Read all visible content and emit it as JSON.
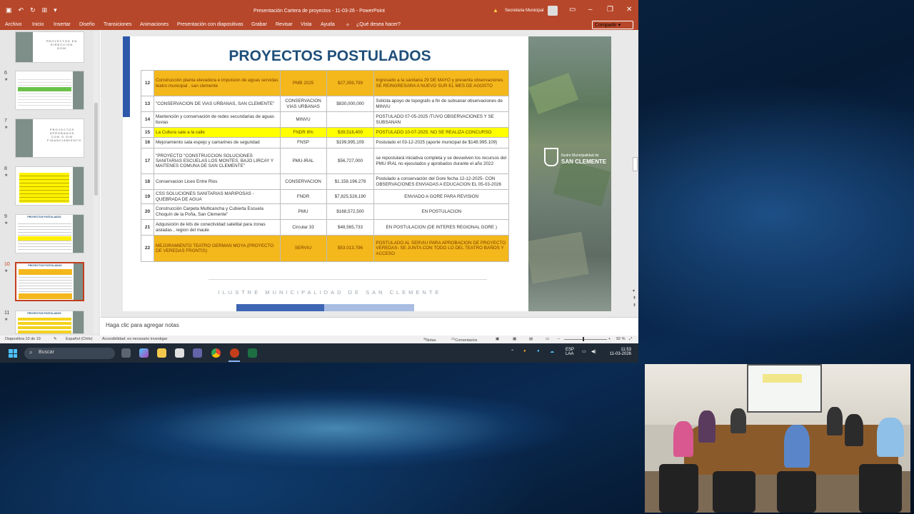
{
  "window": {
    "title": "Presentación Cartera de proyectos - 11-03-26 - PowerPoint",
    "user": "Secretaria Municipal"
  },
  "ribbon": {
    "tabs": [
      "Archivo",
      "Inicio",
      "Insertar",
      "Diseño",
      "Transiciones",
      "Animaciones",
      "Presentación con diapositivas",
      "Grabar",
      "Revisar",
      "Vista",
      "Ayuda"
    ],
    "tell_me": "¿Qué desea hacer?",
    "share": "Compartir"
  },
  "thumbnails": [
    {
      "num": "",
      "caption": "PROYECTOS EN DIRECCIÓN DOM"
    },
    {
      "num": "6",
      "caption": ""
    },
    {
      "num": "7",
      "caption": "PROYECTOS APROBADOS CON O SIN FINANCIAMIENTO"
    },
    {
      "num": "8",
      "caption": ""
    },
    {
      "num": "9",
      "caption": "PROYECTOS POSTULADOS"
    },
    {
      "num": "10",
      "caption": "PROYECTOS POSTULADOS"
    },
    {
      "num": "11",
      "caption": "PROYECTOS POSTULADOS"
    }
  ],
  "slide": {
    "title": "PROYECTOS POSTULADOS",
    "footer": "ILUSTRE MUNICIPALIDAD DE SAN CLEMENTE",
    "logo_line1": "Ilustre Municipalidad de",
    "logo_line2": "SAN CLEMENTE",
    "rows": [
      {
        "n": "12",
        "desc": "Construcción planta elevadora e impulsion de aguas servidas teatro municipal , san clemente",
        "fund": "PMB 2025",
        "amount": "$27,359,799",
        "obs": "Ingresado a la sanitaria 29 DE MAYO y presenta observaciones SE REINGRESARA A NUEVO SUR EL MES DE AGOSTO"
      },
      {
        "n": "13",
        "desc": "\"CONSERVACION DE VIAS URBANAS, SAN CLEMENTE\"",
        "fund": "CONSERVACION VIAS URBANAS",
        "amount": "$830,000,000",
        "obs": "Solicita apoyo de topografo a fin de subsanar observaciones de MINVU"
      },
      {
        "n": "14",
        "desc": "Mantención y conservación de redes secundarias de aguas lluvias",
        "fund": "MINVU",
        "amount": "",
        "obs": "POSTULADO 07-05-2025 /TUVO OBSERVACIONES Y SE SUBSANAN"
      },
      {
        "n": "15",
        "desc": "La Cultura sale a la calle",
        "fund": "FNDR 8%",
        "amount": "$39,518,400",
        "obs": "POSTULADO 10-07-2025. NO SE REALIZA CONCURSO"
      },
      {
        "n": "16",
        "desc": "Mejoramiento sala espejo y camarines de seguridad",
        "fund": "FNSP",
        "amount": "$199,995,109",
        "obs": "Postulado el 03-12-2025 (aporte municipal de $148.995.109)"
      },
      {
        "n": "17",
        "desc": "\"PROYECTO \"CONSTRUCCION SOLUCIONES SANITARIAS ESCUELAS LOS MONTES, BAJO LIRCAY Y MAITENES COMUNA DE SAN CLEMENTE\"",
        "fund": "PMU-IRAL",
        "amount": "$56,727,000",
        "obs": "se repostulará iniciativa completa y se devuelven los recursos del PMU IRAL no ejecutados y aprobados durante el año 2022"
      },
      {
        "n": "18",
        "desc": "Conservacion Liceo Entre Rios",
        "fund": "CONSERVACION",
        "amount": "$1.158.196.278",
        "obs": "Postulado a conservación del Gore fecha 12-12-2025- CON OBSERVACIONES ENVIADAS A EDUCACION EL 05-03-2026"
      },
      {
        "n": "19",
        "desc": "CSS SOLUCIONES SANITARIAS MARIPOSAS - QUEBRADA DE AGUA",
        "fund": "FNDR",
        "amount": "$7,825,526,190",
        "obs": "ENVIADO A GORE PARA REVISION"
      },
      {
        "n": "20",
        "desc": "Construcción Carpeta Multicancha y Cubierta Escuela Choquín de la Poña, San Clemente\"",
        "fund": "PMU",
        "amount": "$168,572,500",
        "obs": "EN POSTULACION"
      },
      {
        "n": "21",
        "desc": "Adquisición de kits de conectividad satelital para zonas aisladas , region del maule",
        "fund": "Circular 33",
        "amount": "$48,565,733",
        "obs": "EN POSTULACION (DE INTERES REGIONAL GORE )"
      },
      {
        "n": "22",
        "desc": "MEJORAMIENTO TEATRO GERMAN MOYA (PROYECTO DE VEREDAS FRONTIS)",
        "fund": "SERVIU",
        "amount": "$53.013.796",
        "obs": "POSTULADO AL SERVIU PARA APROBACION DE PROYECTO VEREDAS- SE JUNTA CON TODO LO DEL TEATRO BAÑOS Y ACCESO"
      }
    ]
  },
  "notes_placeholder": "Haga clic para agregar notas",
  "status": {
    "slide_count": "Diapositiva 10 de 19",
    "language": "Español (Chile)",
    "accessibility": "Accesibilidad: es necesario investigar",
    "notes": "Notas",
    "comments": "Comentarios",
    "zoom": "92 %"
  },
  "taskbar": {
    "search": "Buscar",
    "lang1": "ESP",
    "lang2": "LAA",
    "time": "11:53",
    "date": "11-03-2026"
  }
}
